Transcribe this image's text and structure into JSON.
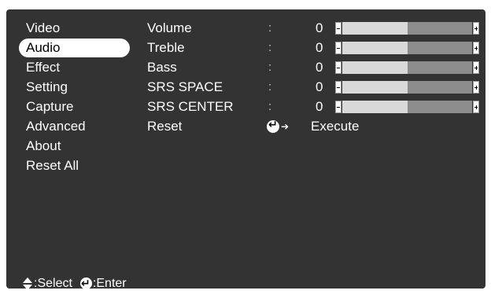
{
  "menu": {
    "items": [
      {
        "label": "Video",
        "selected": false
      },
      {
        "label": "Audio",
        "selected": true
      },
      {
        "label": "Effect",
        "selected": false
      },
      {
        "label": "Setting",
        "selected": false
      },
      {
        "label": "Capture",
        "selected": false
      },
      {
        "label": "Advanced",
        "selected": false
      },
      {
        "label": "About",
        "selected": false
      },
      {
        "label": "Reset All",
        "selected": false
      }
    ]
  },
  "settings": {
    "rows": [
      {
        "label": "Volume",
        "colon": ":",
        "value": "0",
        "level": 0.5
      },
      {
        "label": "Treble",
        "colon": ":",
        "value": "0",
        "level": 0.5
      },
      {
        "label": "Bass",
        "colon": ":",
        "value": "0",
        "level": 0.5
      },
      {
        "label": "SRS SPACE",
        "colon": ":",
        "value": "0",
        "level": 0.5
      },
      {
        "label": "SRS CENTER",
        "colon": ":",
        "value": "0",
        "level": 0.5
      }
    ],
    "reset": {
      "label": "Reset",
      "action": "Execute"
    }
  },
  "footer": {
    "select_label": ":Select",
    "enter_label": ":Enter"
  },
  "colors": {
    "panel": "#333333",
    "highlight": "#ffffff",
    "slider_fill": "#d9d9d9",
    "slider_track": "#8c8c8c"
  }
}
